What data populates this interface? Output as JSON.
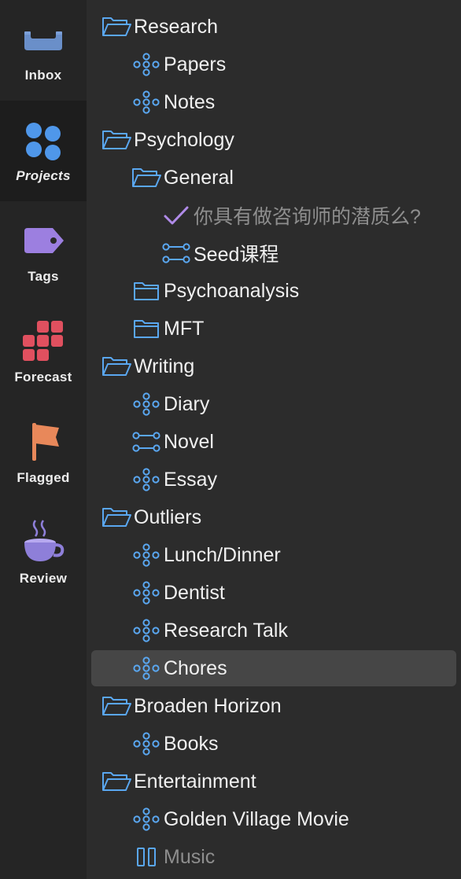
{
  "perspectives": [
    {
      "label": "Inbox",
      "icon": "inbox-tray-icon"
    },
    {
      "label": "Projects",
      "icon": "projects-dots-icon"
    },
    {
      "label": "Tags",
      "icon": "tag-icon"
    },
    {
      "label": "Forecast",
      "icon": "forecast-grid-icon"
    },
    {
      "label": "Flagged",
      "icon": "flag-icon"
    },
    {
      "label": "Review",
      "icon": "coffee-cup-icon"
    }
  ],
  "active_perspective": "Projects",
  "colors": {
    "accent_blue": "#5aa7f0",
    "check_purple": "#b08be8",
    "selection": "#464646"
  },
  "tree": [
    {
      "label": "Research",
      "type": "folder-open"
    },
    {
      "label": "Papers",
      "type": "project-parallel"
    },
    {
      "label": "Notes",
      "type": "project-parallel"
    },
    {
      "label": "Psychology",
      "type": "folder-open"
    },
    {
      "label": "General",
      "type": "folder-open"
    },
    {
      "label": "你具有做咨询师的潜质么?",
      "type": "action-completed"
    },
    {
      "label": "Seed课程",
      "type": "project-sequential"
    },
    {
      "label": "Psychoanalysis",
      "type": "folder-closed"
    },
    {
      "label": "MFT",
      "type": "folder-closed"
    },
    {
      "label": "Writing",
      "type": "folder-open"
    },
    {
      "label": "Diary",
      "type": "project-parallel"
    },
    {
      "label": "Novel",
      "type": "project-sequential"
    },
    {
      "label": "Essay",
      "type": "project-parallel"
    },
    {
      "label": "Outliers",
      "type": "folder-open"
    },
    {
      "label": "Lunch/Dinner",
      "type": "project-parallel"
    },
    {
      "label": "Dentist",
      "type": "project-parallel"
    },
    {
      "label": "Research Talk",
      "type": "project-parallel"
    },
    {
      "label": "Chores",
      "type": "project-parallel",
      "selected": true
    },
    {
      "label": "Broaden Horizon",
      "type": "folder-open"
    },
    {
      "label": "Books",
      "type": "project-parallel"
    },
    {
      "label": "Entertainment",
      "type": "folder-open"
    },
    {
      "label": "Golden Village Movie",
      "type": "project-parallel"
    },
    {
      "label": "Music",
      "type": "project-on-hold",
      "dimmed": true
    }
  ]
}
